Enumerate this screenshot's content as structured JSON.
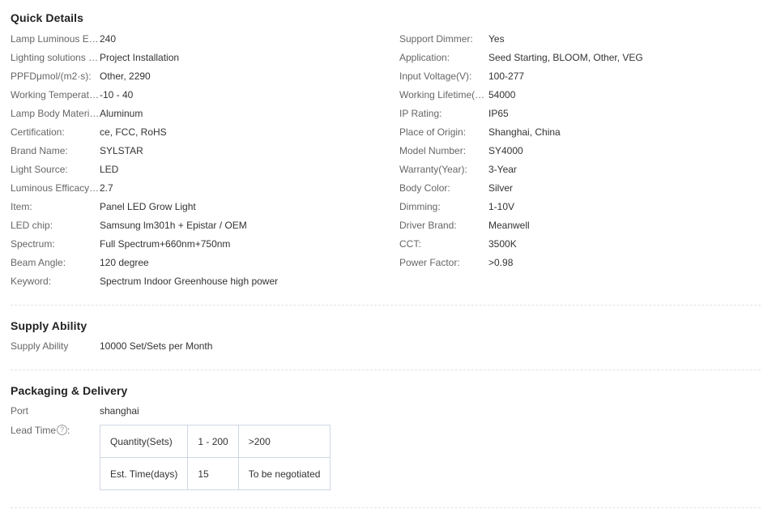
{
  "quick_details": {
    "title": "Quick Details",
    "left": [
      {
        "key": "Lamp Luminous Ef...",
        "value": "240"
      },
      {
        "key": "Lighting solutions s...",
        "value": "Project Installation"
      },
      {
        "key": "PPFDμmol/(m2·s):",
        "value": "Other, 2290"
      },
      {
        "key": "Working Temperatu...",
        "value": "-10 - 40"
      },
      {
        "key": "Lamp Body Material:",
        "value": "Aluminum"
      },
      {
        "key": "Certification:",
        "value": "ce, FCC, RoHS"
      },
      {
        "key": "Brand Name:",
        "value": "SYLSTAR"
      },
      {
        "key": "Light Source:",
        "value": "LED"
      },
      {
        "key": "Luminous Efficacy(...",
        "value": "2.7"
      },
      {
        "key": "Item:",
        "value": "Panel LED Grow Light"
      },
      {
        "key": "LED chip:",
        "value": "Samsung lm301h + Epistar / OEM"
      },
      {
        "key": "Spectrum:",
        "value": "Full Spectrum+660nm+750nm"
      },
      {
        "key": "Beam Angle:",
        "value": "120 degree"
      },
      {
        "key": "Keyword:",
        "value": "Spectrum Indoor Greenhouse high power"
      }
    ],
    "right": [
      {
        "key": "Support Dimmer:",
        "value": "Yes"
      },
      {
        "key": "Application:",
        "value": "Seed Starting, BLOOM, Other, VEG"
      },
      {
        "key": "Input Voltage(V):",
        "value": "100-277"
      },
      {
        "key": "Working Lifetime(H...",
        "value": "54000"
      },
      {
        "key": "IP Rating:",
        "value": "IP65"
      },
      {
        "key": "Place of Origin:",
        "value": "Shanghai, China"
      },
      {
        "key": "Model Number:",
        "value": "SY4000"
      },
      {
        "key": "Warranty(Year):",
        "value": "3-Year"
      },
      {
        "key": "Body Color:",
        "value": "Silver"
      },
      {
        "key": "Dimming:",
        "value": "1-10V"
      },
      {
        "key": "Driver Brand:",
        "value": "Meanwell"
      },
      {
        "key": "CCT:",
        "value": "3500K"
      },
      {
        "key": "Power Factor:",
        "value": ">0.98"
      }
    ]
  },
  "supply_ability": {
    "title": "Supply Ability",
    "key": "Supply Ability",
    "value": "10000 Set/Sets per Month"
  },
  "packaging": {
    "title": "Packaging & Delivery",
    "port_key": "Port",
    "port_value": "shanghai",
    "lead_time_key": "Lead Time",
    "lead_time_suffix": ":",
    "help_icon": "question-circle-icon",
    "help_glyph": "?",
    "lead_table": {
      "rows": [
        [
          "Quantity(Sets)",
          "1 - 200",
          ">200"
        ],
        [
          "Est. Time(days)",
          "15",
          "To be negotiated"
        ]
      ]
    }
  }
}
